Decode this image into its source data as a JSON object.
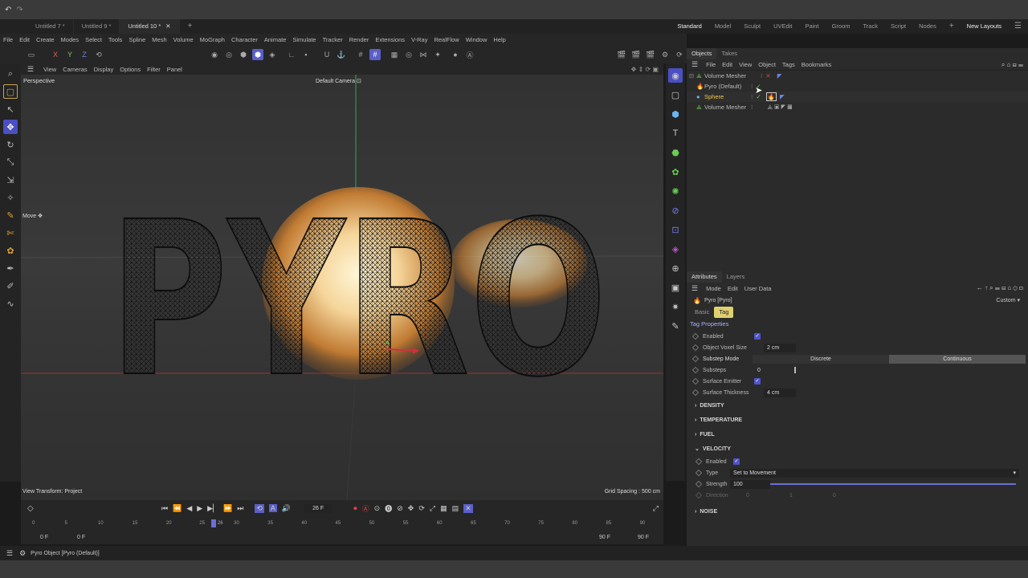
{
  "tabs": [
    "Untitled 7 *",
    "Untitled 9 *",
    "Untitled 10 *"
  ],
  "layouts": [
    "Standard",
    "Model",
    "Sculpt",
    "UVEdit",
    "Paint",
    "Groom",
    "Track",
    "Script",
    "Nodes"
  ],
  "new_layouts": "New Layouts",
  "menu": [
    "File",
    "Edit",
    "Create",
    "Modes",
    "Select",
    "Tools",
    "Spline",
    "Mesh",
    "Volume",
    "MoGraph",
    "Character",
    "Animate",
    "Simulate",
    "Tracker",
    "Render",
    "Extensions",
    "V-Ray",
    "RealFlow",
    "Window",
    "Help"
  ],
  "viewport": {
    "menu": [
      "View",
      "Cameras",
      "Display",
      "Options",
      "Filter",
      "Panel"
    ],
    "label": "Perspective",
    "camera": "Default Camera",
    "move_label": "Move",
    "text": "PYRO",
    "view_transform": "View Transform: Project",
    "grid_spacing": "Grid Spacing : 500 cm"
  },
  "timeline": {
    "frame": "26 F",
    "ticks": [
      "0",
      "5",
      "10",
      "15",
      "20",
      "25",
      "30",
      "35",
      "40",
      "45",
      "50",
      "55",
      "60",
      "65",
      "70",
      "75",
      "80",
      "85",
      "90"
    ],
    "start": "0 F",
    "start2": "0 F",
    "end": "90 F",
    "end2": "90 F",
    "current": "26"
  },
  "status": "Pyro Object [Pyro (Default)]",
  "objects": {
    "tabs": [
      "Objects",
      "Takes"
    ],
    "menu": [
      "File",
      "Edit",
      "View",
      "Object",
      "Tags",
      "Bookmarks"
    ],
    "rows": [
      {
        "name": "Volume Mesher",
        "color": "#bbbbbb"
      },
      {
        "name": "Pyro (Default)",
        "color": "#bbbbbb"
      },
      {
        "name": "Sphere",
        "color": "#f2c94c"
      },
      {
        "name": "Volume Mesher",
        "color": "#bbbbbb"
      }
    ]
  },
  "attributes": {
    "tabs": [
      "Attributes",
      "Layers"
    ],
    "menu": [
      "Mode",
      "Edit",
      "User Data"
    ],
    "title": "Pyro [Pyro]",
    "preset": "Custom",
    "subtabs": [
      "Basic",
      "Tag"
    ],
    "section": "Tag Properties",
    "enabled": "Enabled",
    "voxel_label": "Object Voxel Size",
    "voxel_value": "2 cm",
    "substep_label": "Substep Mode",
    "substep_a": "Discrete",
    "substep_b": "Continuous",
    "substeps_label": "Substeps",
    "substeps_value": "0",
    "surface_emitter": "Surface Emitter",
    "thickness_label": "Surface Thickness",
    "thickness_value": "4 cm",
    "groups": [
      "DENSITY",
      "TEMPERATURE",
      "FUEL"
    ],
    "velocity": "VELOCITY",
    "vel_enabled": "Enabled",
    "type_label": "Type",
    "type_value": "Set to Movement",
    "strength_label": "Strength",
    "strength_value": "100",
    "direction_label": "Direction",
    "dir_x": "0",
    "dir_y": "1",
    "dir_z": "0",
    "noise": "NOISE"
  }
}
